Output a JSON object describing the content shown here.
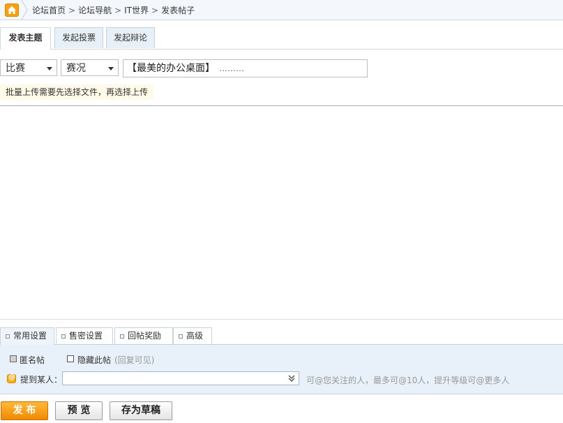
{
  "breadcrumb": {
    "items": [
      "论坛首页",
      "论坛导航",
      "IT世界",
      "发表帖子"
    ],
    "separator": ">"
  },
  "tabs": [
    {
      "label": "发表主题",
      "active": true
    },
    {
      "label": "发起投票",
      "active": false
    },
    {
      "label": "发起辩论",
      "active": false
    }
  ],
  "form": {
    "category_select": "比赛",
    "subcategory_select": "赛况",
    "title_value": "【最美的办公桌面】",
    "title_dots": "………",
    "notice": "批量上传需要先选择文件，再选择上传"
  },
  "settings_tabs": [
    {
      "label": "常用设置",
      "active": true
    },
    {
      "label": "售密设置",
      "active": false
    },
    {
      "label": "回帖奖励",
      "active": false
    },
    {
      "label": "高级",
      "active": false
    }
  ],
  "settings": {
    "anonymous_label": "匿名帖",
    "hide_label": "隐藏此帖",
    "hide_hint": "(回复可见)",
    "mention_label": "提到某人：",
    "mention_value": "",
    "mention_hint": "可@您关注的人，最多可@10人，提升等级可@更多人"
  },
  "buttons": {
    "publish": "发 布",
    "preview": "预 览",
    "save_draft": "存为草稿"
  },
  "colors": {
    "accent": "#f08a00",
    "tab_bg": "#e8f0f7",
    "settings_bg": "#e8f1f9"
  }
}
